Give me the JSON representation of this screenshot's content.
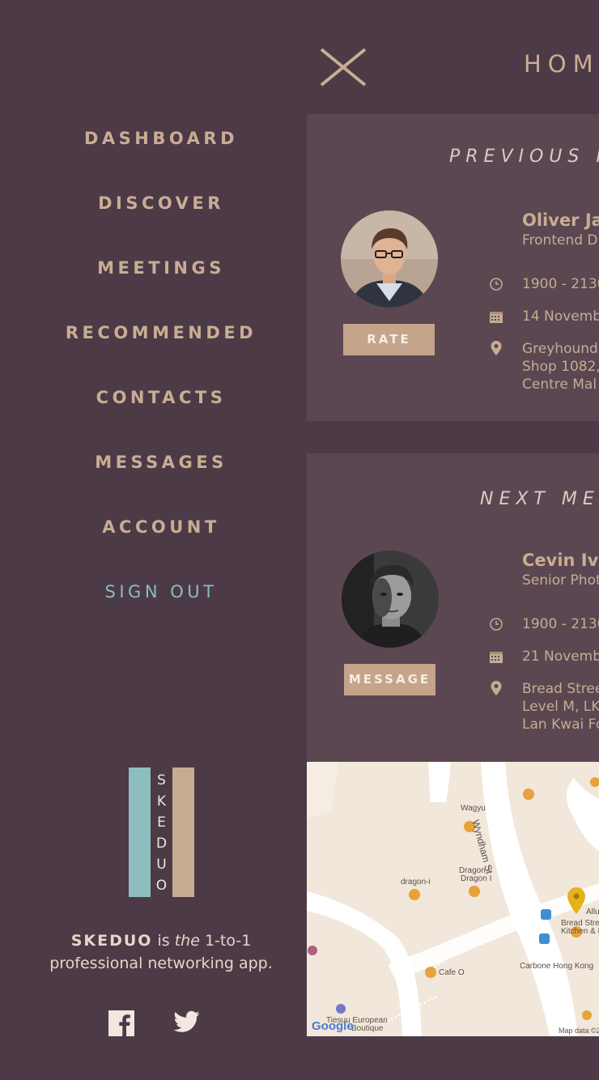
{
  "nav": {
    "items": [
      {
        "label": "DASHBOARD"
      },
      {
        "label": "DISCOVER"
      },
      {
        "label": "MEETINGS"
      },
      {
        "label": "RECOMMENDED"
      },
      {
        "label": "CONTACTS"
      },
      {
        "label": "MESSAGES"
      },
      {
        "label": "ACCOUNT"
      }
    ],
    "signout": "SIGN OUT"
  },
  "logo": {
    "letters": [
      "S",
      "K",
      "E",
      "D",
      "U",
      "O"
    ]
  },
  "tagline": {
    "brand": "SKEDUO",
    "part1": " is ",
    "emphasis": "the",
    "part2": " 1-to-1",
    "line2": "professional networking app."
  },
  "social": {
    "icons": [
      "facebook-icon",
      "twitter-icon"
    ]
  },
  "header": {
    "title": "HOM"
  },
  "previous_meeting": {
    "title": "PREVIOUS M",
    "name": "Oliver Jal",
    "role": "Frontend D",
    "time": "1900 - 2130",
    "date": "14 Novemb",
    "location": [
      "Greyhound",
      "Shop 1082,",
      "Centre Mal"
    ],
    "button": "RATE"
  },
  "next_meeting": {
    "title": "NEXT MEE",
    "name": "Cevin Iva",
    "role": "Senior Phot",
    "time": "1900 - 2130",
    "date": "21 Novemb",
    "location": [
      "Bread Stree",
      "Level M, LK",
      "Lan Kwai Fo"
    ],
    "button": "MESSAGE"
  },
  "map": {
    "labels": {
      "wagyu": "Wagyu",
      "wyndham": "Wyndham St",
      "dragon1": "Dragon-i",
      "dragon2": "Dragon I",
      "dragon3": "dragon-i",
      "cafe": "Cafe O",
      "carbone": "Carbone Hong Kong",
      "bread": "Bread Stre",
      "kitchen": "Kitchen & E",
      "allu": "Allu",
      "tiesuu": "Tiesuu European",
      "boutique": "Boutique",
      "mapdata": "Map data ©2",
      "google": "Google"
    }
  },
  "colors": {
    "background": "#4c3a47",
    "card": "#5b4751",
    "accent_tan": "#c9ad93",
    "accent_teal": "#8abcbe"
  }
}
